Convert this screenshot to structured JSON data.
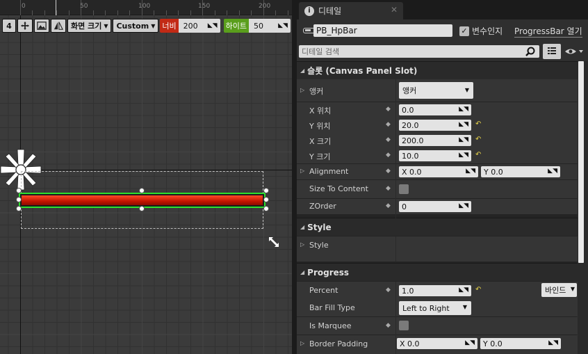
{
  "designer": {
    "ruler": {
      "ticks": [
        "0",
        "50",
        "100",
        "150",
        "200"
      ]
    },
    "toolbar": {
      "dpi_value": "4",
      "screen_size_label": "화면 크기",
      "preset_label": "Custom",
      "width_label": "너비",
      "width_value": "200",
      "height_label": "하이트",
      "height_value": "50"
    },
    "colors": {
      "fill_top": "#ff4a2a",
      "fill_bottom": "#8a0d00",
      "selection_outline": "#2de02d"
    }
  },
  "details": {
    "tab_title": "디테일",
    "widget_name": "PB_HpBar",
    "is_variable_label": "변수인지",
    "open_class_label": "ProgressBar 열기",
    "search_placeholder": "디테일 검색",
    "slot_section": {
      "title": "슬롯 (Canvas Panel Slot)",
      "anchors_label": "앵커",
      "anchors_value": "앵커",
      "pos_x_label": "X 위치",
      "pos_x_value": "0.0",
      "pos_y_label": "Y 위치",
      "pos_y_value": "20.0",
      "size_x_label": "X 크기",
      "size_x_value": "200.0",
      "size_y_label": "Y 크기",
      "size_y_value": "10.0",
      "alignment_label": "Alignment",
      "alignment_x": "X  0.0",
      "alignment_y": "Y  0.0",
      "size_to_content_label": "Size To Content",
      "zorder_label": "ZOrder",
      "zorder_value": "0"
    },
    "style_section": {
      "title": "Style",
      "style_label": "Style"
    },
    "progress_section": {
      "title": "Progress",
      "percent_label": "Percent",
      "percent_value": "1.0",
      "bind_label": "바인드",
      "bar_fill_type_label": "Bar Fill Type",
      "bar_fill_type_value": "Left to Right",
      "is_marquee_label": "Is Marquee",
      "border_padding_label": "Border Padding",
      "border_padding_x": "X  0.0",
      "border_padding_y": "Y  0.0"
    }
  }
}
